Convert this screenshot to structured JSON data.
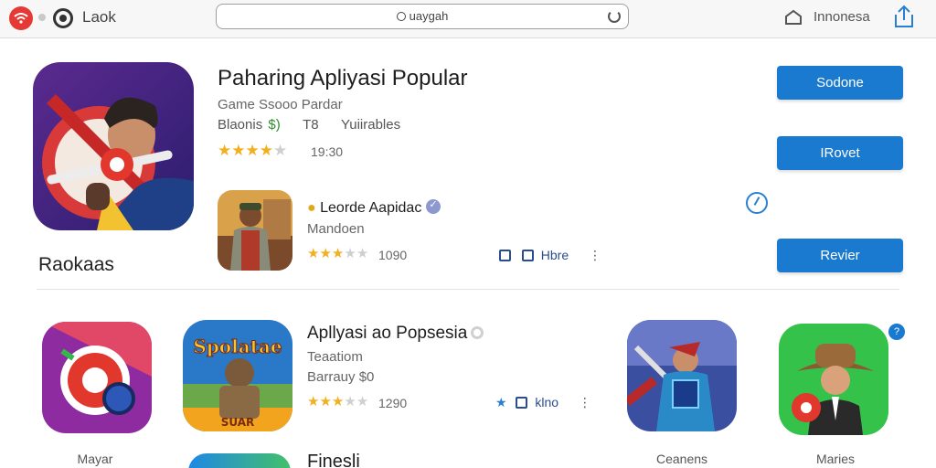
{
  "topbar": {
    "title": "Laok",
    "search_text": "uaygah",
    "region": "Innonesa"
  },
  "featured": {
    "title": "Paharing Apliyasi  Popular",
    "subtitle": "Game Ssooo  Pardar",
    "meta_a": "Blaonis",
    "meta_b": "$)",
    "meta_c": "T8",
    "meta_d": "Yuiirables",
    "rating": 4,
    "rating_count": "19:30"
  },
  "buttons": {
    "first": "Sodone",
    "second": "IRovet",
    "third": "Revier"
  },
  "section_label": "Raokaas",
  "list_items": [
    {
      "title": "Leorde Aapidac",
      "subtitle": "Mandoen",
      "rating": 3,
      "rating_count": "1090",
      "action_label": "Hbre"
    },
    {
      "title": "Apllyasi ao Popsesia",
      "subtitle": "Teaatiom",
      "subtitle2": "Barrauy $0",
      "rating": 3,
      "rating_count": "1290",
      "action_label": "klno"
    }
  ],
  "grid": {
    "item1_caption": "Mayar",
    "item2_banner": "Spolatae",
    "item2_banner_bottom": "SUAR",
    "item3_caption": "Ceanens",
    "item4_caption": "Maries",
    "item4_badge": "?"
  },
  "bottom_title": "Finesli",
  "colors": {
    "accent": "#1a7ad0",
    "star": "#f2b01e",
    "icon_bg_purple": "#5b2a8f",
    "green": "#2ecc40"
  }
}
